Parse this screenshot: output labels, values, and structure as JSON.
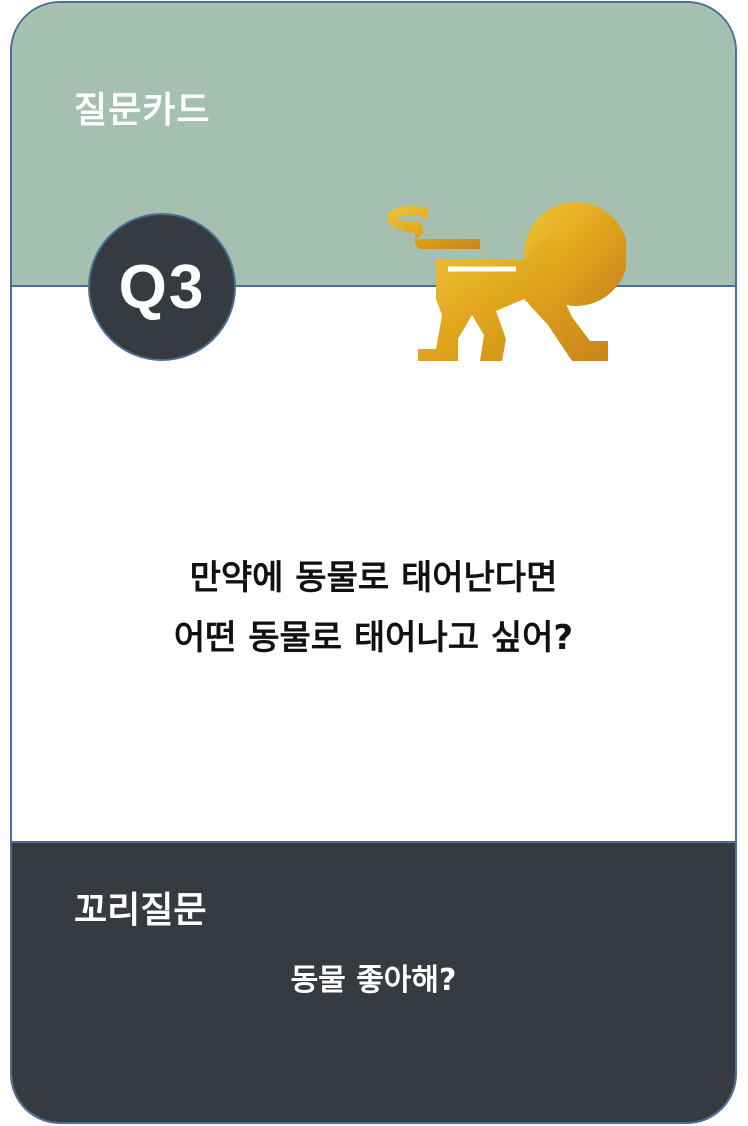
{
  "card": {
    "type_label": "질문카드",
    "number": "Q3",
    "icon": "lion-icon",
    "colors": {
      "top_band": "#a5bfb1",
      "badge": "#353b41",
      "bottom_band": "#353b41",
      "border": "#4a6f96",
      "lion_gold": "#e0a820"
    }
  },
  "question": {
    "line1": "만약에 동물로 태어난다면",
    "line2": "어떤 동물로 태어나고 싶어?"
  },
  "tail": {
    "title": "꼬리질문",
    "question": "동물 좋아해?"
  }
}
